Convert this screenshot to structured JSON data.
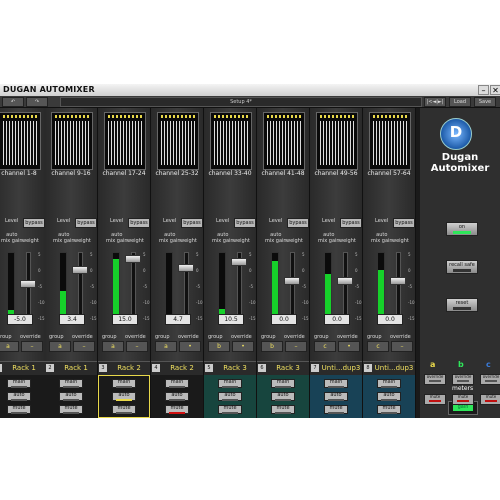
{
  "window": {
    "title": "DUGAN AUTOMIXER"
  },
  "toolbar": {
    "undo": "↶",
    "redo": "↷",
    "setup": "Setup 4*",
    "nav": "|<◄|►|",
    "load": "Load",
    "save": "Save"
  },
  "labels": {
    "level": "Level",
    "bypass": "bypass",
    "auto": "auto\nmix gain",
    "weight": "weight",
    "group": "group",
    "override": "override",
    "main": "main",
    "autob": "auto",
    "mute": "mute",
    "scale": [
      "5",
      "0",
      "-5",
      "-10",
      "-15"
    ]
  },
  "channels": [
    {
      "name": "channel 1-8",
      "gain": "-5.0",
      "meter": 0.18,
      "fader": 0.55,
      "group": "a",
      "rack_num": "",
      "rack": "Rack 1"
    },
    {
      "name": "channel 9-16",
      "gain": "3.4",
      "meter": 0.45,
      "fader": 0.78,
      "group": "a",
      "rack_num": "2",
      "rack": "Rack 1"
    },
    {
      "name": "channel 17-24",
      "gain": "15.0",
      "meter": 0.92,
      "fader": 0.95,
      "group": "a",
      "rack_num": "3",
      "rack": "Rack 2"
    },
    {
      "name": "channel 25-32",
      "gain": "4.7",
      "meter": 0.02,
      "fader": 0.8,
      "group": "a",
      "rack_num": "4",
      "rack": "Rack 2"
    },
    {
      "name": "channel 33-40",
      "gain": "10.5",
      "meter": 0.2,
      "fader": 0.9,
      "group": "b",
      "rack_num": "5",
      "rack": "Rack 3"
    },
    {
      "name": "channel 41-48",
      "gain": "0.0",
      "meter": 0.88,
      "fader": 0.6,
      "group": "b",
      "rack_num": "6",
      "rack": "Rack 3"
    },
    {
      "name": "channel 49-56",
      "gain": "0.0",
      "meter": 0.7,
      "fader": 0.6,
      "group": "c",
      "rack_num": "7",
      "rack": "Unti...dup3"
    },
    {
      "name": "channel 57-64",
      "gain": "0.0",
      "meter": 0.75,
      "fader": 0.6,
      "group": "c",
      "rack_num": "8",
      "rack": "Unti...dup3"
    }
  ],
  "side": {
    "logo": "D",
    "brand": "Dugan\nAutomixer",
    "on": "on",
    "recall": "recall safe",
    "reset": "reset",
    "meters_label": "meters",
    "meters_state": "gain"
  },
  "groups": [
    {
      "letter": "a",
      "override": "override",
      "mute": "mute"
    },
    {
      "letter": "b",
      "override": "override",
      "mute": "mute"
    },
    {
      "letter": "c",
      "override": "override",
      "mute": "mute"
    }
  ],
  "colors": {
    "green": "#16d12a",
    "yellow_label": "#f0e060",
    "blue_logo": "#1c5aa8"
  }
}
